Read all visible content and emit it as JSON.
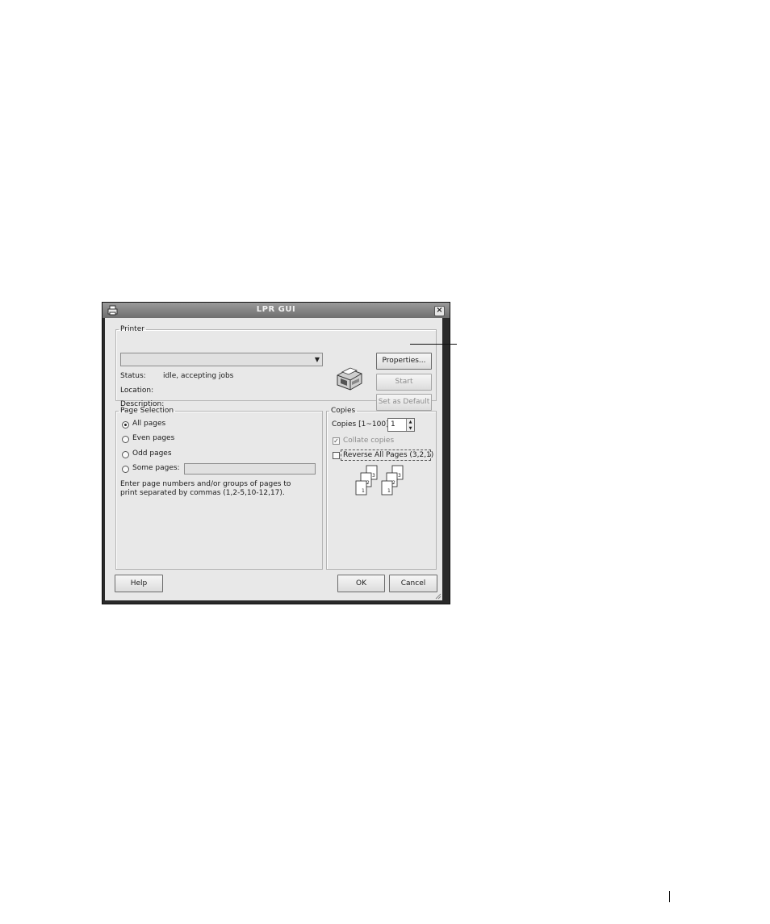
{
  "window": {
    "title": "LPR GUI",
    "close_glyph": "×",
    "app_icon": "printer-app-icon"
  },
  "printer_group": {
    "legend": "Printer",
    "selected_printer": "",
    "status_label": "Status:",
    "status_value": "idle, accepting jobs",
    "location_label": "Location:",
    "location_value": "",
    "description_label": "Description:",
    "description_value": "",
    "printer_icon": "printer-icon",
    "properties_label": "Properties...",
    "start_label": "Start",
    "set_default_label": "Set as Default"
  },
  "page_selection": {
    "legend": "Page Selection",
    "options": [
      "All pages",
      "Even pages",
      "Odd pages",
      "Some pages:"
    ],
    "selected_index": 0,
    "some_pages_value": "",
    "hint": "Enter page numbers and/or groups of pages to print separated by commas (1,2-5,10-12,17)."
  },
  "copies": {
    "legend": "Copies",
    "copies_label": "Copies [1~100]:",
    "copies_value": "1",
    "collate_label": "Collate copies",
    "collate_checked": true,
    "collate_enabled": false,
    "reverse_label": "Reverse All Pages (3,2,1)",
    "reverse_checked": false,
    "preview_pages": [
      "3",
      "2",
      "1"
    ]
  },
  "footer": {
    "help_label": "Help",
    "ok_label": "OK",
    "cancel_label": "Cancel"
  },
  "colors": {
    "dialog_bg": "#e8e8e8",
    "titlebar": "#7a7a7a",
    "frame": "#2a2a2a"
  }
}
